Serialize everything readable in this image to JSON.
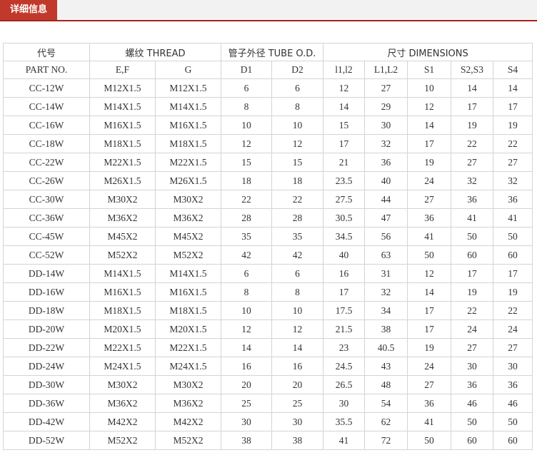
{
  "tab": {
    "label": "详细信息"
  },
  "table": {
    "group_headers": [
      {
        "label": "代号",
        "colspan": 1
      },
      {
        "label": "螺纹 THREAD",
        "colspan": 2
      },
      {
        "label": "管子外径 TUBE O.D.",
        "colspan": 2
      },
      {
        "label": "尺寸 DIMENSIONS",
        "colspan": 5
      }
    ],
    "columns": [
      "PART NO.",
      "E,F",
      "G",
      "D1",
      "D2",
      "l1,l2",
      "L1,L2",
      "S1",
      "S2,S3",
      "S4"
    ],
    "rows": [
      [
        "CC-12W",
        "M12X1.5",
        "M12X1.5",
        "6",
        "6",
        "12",
        "27",
        "10",
        "14",
        "14"
      ],
      [
        "CC-14W",
        "M14X1.5",
        "M14X1.5",
        "8",
        "8",
        "14",
        "29",
        "12",
        "17",
        "17"
      ],
      [
        "CC-16W",
        "M16X1.5",
        "M16X1.5",
        "10",
        "10",
        "15",
        "30",
        "14",
        "19",
        "19"
      ],
      [
        "CC-18W",
        "M18X1.5",
        "M18X1.5",
        "12",
        "12",
        "17",
        "32",
        "17",
        "22",
        "22"
      ],
      [
        "CC-22W",
        "M22X1.5",
        "M22X1.5",
        "15",
        "15",
        "21",
        "36",
        "19",
        "27",
        "27"
      ],
      [
        "CC-26W",
        "M26X1.5",
        "M26X1.5",
        "18",
        "18",
        "23.5",
        "40",
        "24",
        "32",
        "32"
      ],
      [
        "CC-30W",
        "M30X2",
        "M30X2",
        "22",
        "22",
        "27.5",
        "44",
        "27",
        "36",
        "36"
      ],
      [
        "CC-36W",
        "M36X2",
        "M36X2",
        "28",
        "28",
        "30.5",
        "47",
        "36",
        "41",
        "41"
      ],
      [
        "CC-45W",
        "M45X2",
        "M45X2",
        "35",
        "35",
        "34.5",
        "56",
        "41",
        "50",
        "50"
      ],
      [
        "CC-52W",
        "M52X2",
        "M52X2",
        "42",
        "42",
        "40",
        "63",
        "50",
        "60",
        "60"
      ],
      [
        "DD-14W",
        "M14X1.5",
        "M14X1.5",
        "6",
        "6",
        "16",
        "31",
        "12",
        "17",
        "17"
      ],
      [
        "DD-16W",
        "M16X1.5",
        "M16X1.5",
        "8",
        "8",
        "17",
        "32",
        "14",
        "19",
        "19"
      ],
      [
        "DD-18W",
        "M18X1.5",
        "M18X1.5",
        "10",
        "10",
        "17.5",
        "34",
        "17",
        "22",
        "22"
      ],
      [
        "DD-20W",
        "M20X1.5",
        "M20X1.5",
        "12",
        "12",
        "21.5",
        "38",
        "17",
        "24",
        "24"
      ],
      [
        "DD-22W",
        "M22X1.5",
        "M22X1.5",
        "14",
        "14",
        "23",
        "40.5",
        "19",
        "27",
        "27"
      ],
      [
        "DD-24W",
        "M24X1.5",
        "M24X1.5",
        "16",
        "16",
        "24.5",
        "43",
        "24",
        "30",
        "30"
      ],
      [
        "DD-30W",
        "M30X2",
        "M30X2",
        "20",
        "20",
        "26.5",
        "48",
        "27",
        "36",
        "36"
      ],
      [
        "DD-36W",
        "M36X2",
        "M36X2",
        "25",
        "25",
        "30",
        "54",
        "36",
        "46",
        "46"
      ],
      [
        "DD-42W",
        "M42X2",
        "M42X2",
        "30",
        "30",
        "35.5",
        "62",
        "41",
        "50",
        "50"
      ],
      [
        "DD-52W",
        "M52X2",
        "M52X2",
        "38",
        "38",
        "41",
        "72",
        "50",
        "60",
        "60"
      ]
    ]
  }
}
